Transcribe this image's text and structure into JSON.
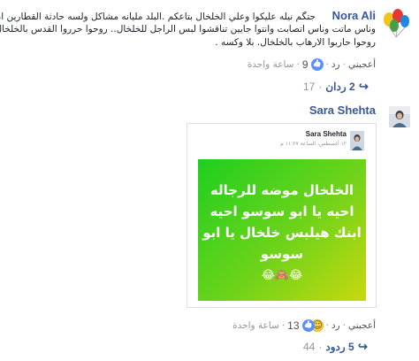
{
  "comments": [
    {
      "author": "Nora Ali",
      "text_lines": [
        "جتگم نيله عليكوا وعلي الخلخال بتاعكم .البلد مليانه مشاكل ولسه حادثة القطارين امبارح",
        "وناس ماتت وناس اتصابت وانتوا جايين تناقشوا لبس الراجل للخلخال.. روحوا حرروا القدس بالخلخال",
        "روحوا حاربوا الارهاب بالخلخال. بلا وكسه ."
      ],
      "like_label": "أعجبني",
      "reply_label": "رد",
      "reaction_count": "9",
      "timestamp": "ساعة واحدة",
      "replies_label": "2 ردان",
      "replies_extra": "17"
    },
    {
      "author": "Sara Shehta",
      "shared_post": {
        "author": "Sara Shehta",
        "timestamp": "١٢ أغسطس، الساعة ١١:٢٧ م",
        "lines": [
          "الخلخال موضه للرجاله",
          "احيه يا ابو سوسو احيه",
          "ابنك هيلبس خلخال يا ابو",
          "سوسو",
          "😂🙈😂"
        ]
      },
      "like_label": "أعجبني",
      "reply_label": "رد",
      "reaction_count": "13",
      "timestamp": "ساعة واحدة",
      "replies_label": "5 ردود",
      "replies_extra": "44"
    }
  ],
  "colors": {
    "name": "#365899",
    "post_gradient_start": "#1fcf1f",
    "post_gradient_end": "#c8d80f",
    "meta": "#90949c"
  },
  "icons": {
    "avatar1": "balloons-avatar",
    "reactions1": "like-icon",
    "reactions2": [
      "like-icon",
      "laugh-icon"
    ],
    "reply": "reply-arrow-icon"
  }
}
